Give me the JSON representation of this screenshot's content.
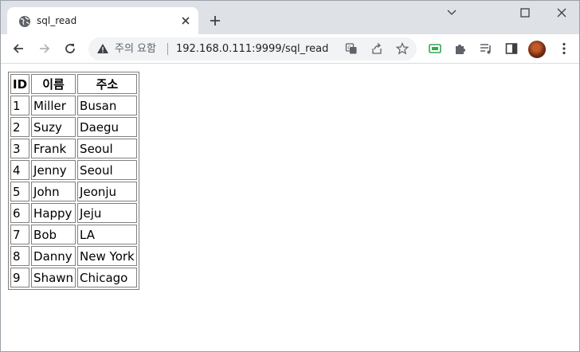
{
  "tab": {
    "title": "sql_read"
  },
  "toolbar": {
    "security_warning": "주의 요함",
    "url": "192.168.0.111:9999/sql_read"
  },
  "table": {
    "headers": {
      "id": "ID",
      "name": "이름",
      "address": "주소"
    },
    "rows": [
      {
        "id": "1",
        "name": "Miller",
        "address": "Busan"
      },
      {
        "id": "2",
        "name": "Suzy",
        "address": "Daegu"
      },
      {
        "id": "3",
        "name": "Frank",
        "address": "Seoul"
      },
      {
        "id": "4",
        "name": "Jenny",
        "address": "Seoul"
      },
      {
        "id": "5",
        "name": "John",
        "address": "Jeonju"
      },
      {
        "id": "6",
        "name": "Happy",
        "address": "Jeju"
      },
      {
        "id": "7",
        "name": "Bob",
        "address": "LA"
      },
      {
        "id": "8",
        "name": "Danny",
        "address": "New York"
      },
      {
        "id": "9",
        "name": "Shawn",
        "address": "Chicago"
      }
    ]
  },
  "icons": {
    "favicon": "globe-icon",
    "back": "back-arrow-icon",
    "forward": "forward-arrow-icon",
    "reload": "reload-icon",
    "warning": "warning-triangle-icon",
    "translate": "translate-icon",
    "share": "share-icon",
    "bookmark": "star-icon",
    "extension1": "green-extension-icon",
    "extensions": "puzzle-icon",
    "reading_list": "media-queue-icon",
    "side_panel": "side-panel-icon",
    "menu": "kebab-menu-icon"
  },
  "colors": {
    "tabstrip": "#dee1e6",
    "omnibox": "#f1f3f4",
    "extension_green": "#34a853",
    "table_border": "#808080"
  }
}
